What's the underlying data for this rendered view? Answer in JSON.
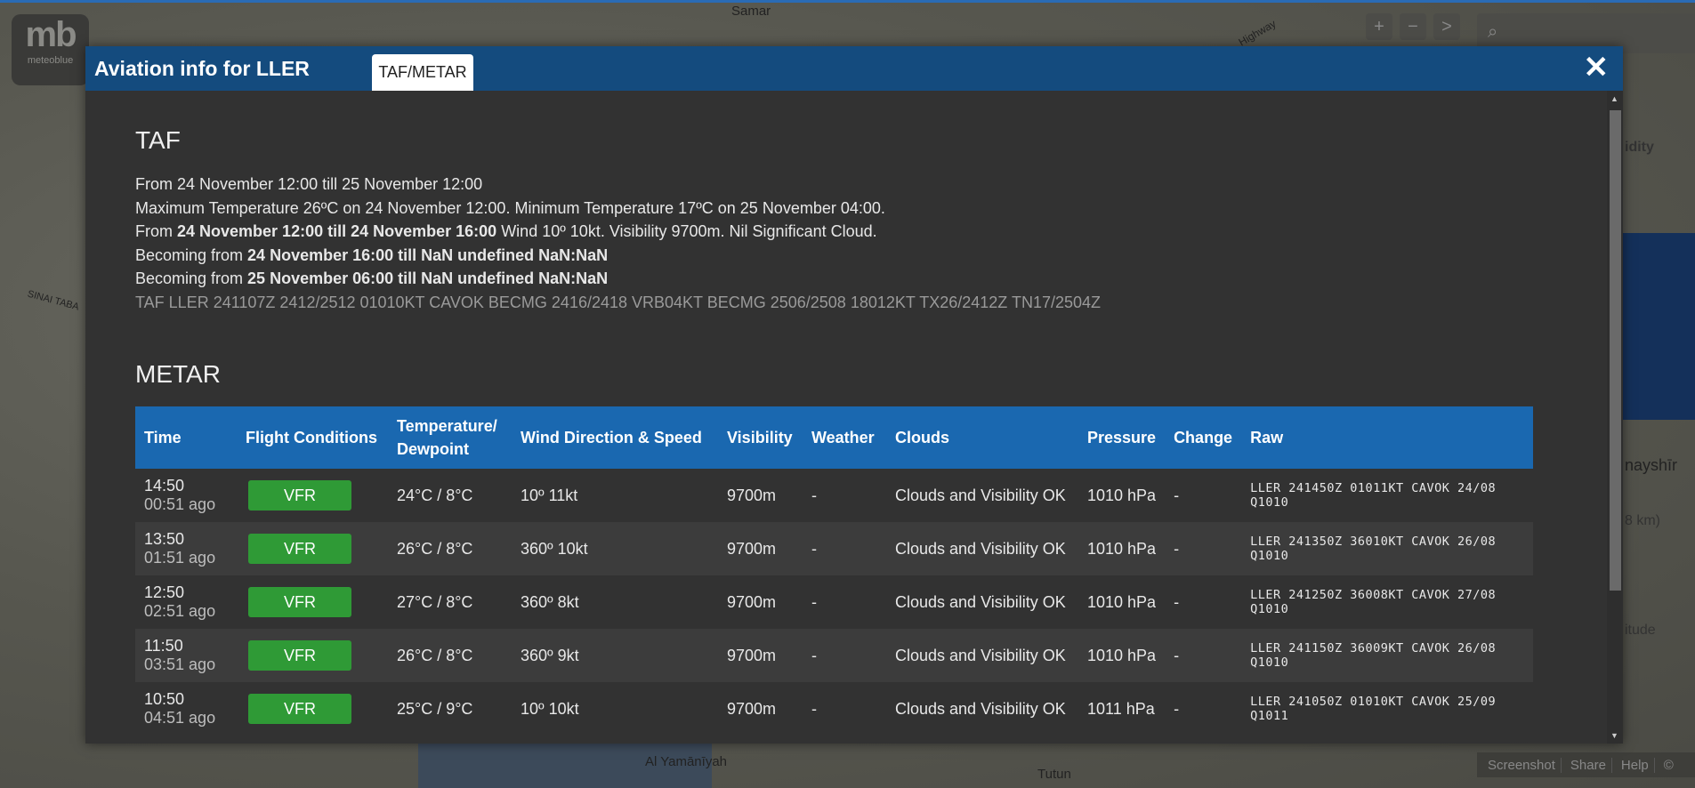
{
  "map": {
    "labels": [
      "Samar",
      "Highway",
      "SINAI TABA",
      "Al Yamānīyah",
      "Tutun",
      "nayshīr",
      "8 km)",
      "idity",
      "itude"
    ],
    "controls": {
      "zoom_in": "+",
      "zoom_out": "−",
      "next": ">",
      "search_icon": "search-icon"
    },
    "footer": [
      "Screenshot",
      "Share",
      "Help",
      "©"
    ]
  },
  "logo": {
    "mark": "mb",
    "text": "meteoblue"
  },
  "modal": {
    "title": "Aviation info for LLER",
    "tab": "TAF/METAR",
    "close": "✕"
  },
  "taf": {
    "heading": "TAF",
    "line1": "From 24 November 12:00 till 25 November 12:00",
    "line2": "Maximum Temperature 26ºC on 24 November 12:00. Minimum Temperature 17ºC on 25 November 04:00.",
    "line3": {
      "prefix": "From ",
      "bold": "24 November 12:00 till 24 November 16:00",
      "suffix": " Wind 10º 10kt. Visibility 9700m. Nil Significant Cloud."
    },
    "line4": {
      "prefix": "Becoming from ",
      "bold": "24 November 16:00 till NaN undefined NaN:NaN"
    },
    "line5": {
      "prefix": "Becoming from ",
      "bold": "25 November 06:00 till NaN undefined NaN:NaN"
    },
    "raw": "TAF LLER 241107Z 2412/2512 01010KT CAVOK BECMG 2416/2418 VRB04KT BECMG 2506/2508 18012KT TX26/2412Z TN17/2504Z"
  },
  "metar": {
    "heading": "METAR",
    "columns": [
      "Time",
      "Flight Conditions",
      "Temperature/ Dewpoint",
      "Wind Direction & Speed",
      "Visibility",
      "Weather",
      "Clouds",
      "Pressure",
      "Change",
      "Raw"
    ],
    "rows": [
      {
        "time": "14:50",
        "ago": "00:51 ago",
        "fc": "VFR",
        "temp": "24°C / 8°C",
        "wind": "10º 11kt",
        "vis": "9700m",
        "wx": "-",
        "clouds": "Clouds and Visibility OK",
        "pres": "1010 hPa",
        "change": "-",
        "raw": "LLER 241450Z 01011KT CAVOK 24/08 Q1010"
      },
      {
        "time": "13:50",
        "ago": "01:51 ago",
        "fc": "VFR",
        "temp": "26°C / 8°C",
        "wind": "360º 10kt",
        "vis": "9700m",
        "wx": "-",
        "clouds": "Clouds and Visibility OK",
        "pres": "1010 hPa",
        "change": "-",
        "raw": "LLER 241350Z 36010KT CAVOK 26/08 Q1010"
      },
      {
        "time": "12:50",
        "ago": "02:51 ago",
        "fc": "VFR",
        "temp": "27°C / 8°C",
        "wind": "360º 8kt",
        "vis": "9700m",
        "wx": "-",
        "clouds": "Clouds and Visibility OK",
        "pres": "1010 hPa",
        "change": "-",
        "raw": "LLER 241250Z 36008KT CAVOK 27/08 Q1010"
      },
      {
        "time": "11:50",
        "ago": "03:51 ago",
        "fc": "VFR",
        "temp": "26°C / 8°C",
        "wind": "360º 9kt",
        "vis": "9700m",
        "wx": "-",
        "clouds": "Clouds and Visibility OK",
        "pres": "1010 hPa",
        "change": "-",
        "raw": "LLER 241150Z 36009KT CAVOK 26/08 Q1010"
      },
      {
        "time": "10:50",
        "ago": "04:51 ago",
        "fc": "VFR",
        "temp": "25°C / 9°C",
        "wind": "10º 10kt",
        "vis": "9700m",
        "wx": "-",
        "clouds": "Clouds and Visibility OK",
        "pres": "1011 hPa",
        "change": "-",
        "raw": "LLER 241050Z 01010KT CAVOK 25/09 Q1011"
      }
    ]
  },
  "colors": {
    "header": "#144b7e",
    "table_header": "#1a68b0",
    "vfr": "#2f9a36"
  }
}
